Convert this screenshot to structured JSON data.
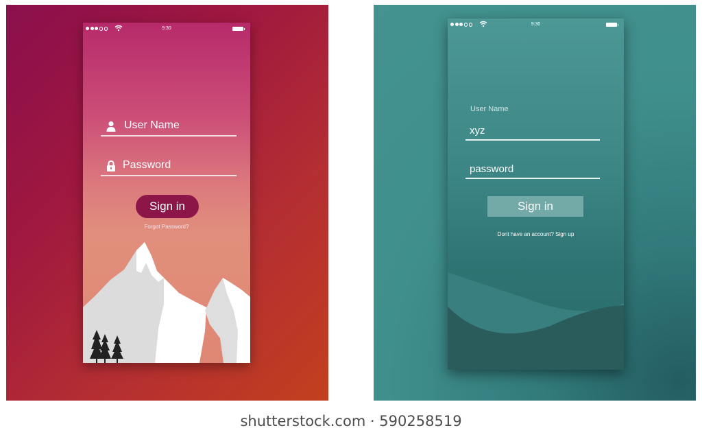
{
  "left_mockup": {
    "status": {
      "time": "9:30"
    },
    "username_label": "User Name",
    "password_label": "Password",
    "signin_label": "Sign in",
    "forgot_label": "Forgot Password?",
    "colors": {
      "accent": "#8c1648",
      "bg_top": "#b72a6a",
      "bg_bottom": "#e18f7c"
    }
  },
  "right_mockup": {
    "status": {
      "time": "9:30"
    },
    "username_caption": "User Name",
    "username_value": "xyz",
    "password_value": "password",
    "signin_label": "Sign in",
    "signup_label": "Dont have an account? Sign up",
    "colors": {
      "accent": "#73aaa7",
      "bg": "#3f8f8d"
    }
  },
  "watermark": "shutterstock.com · 590258519",
  "icons": [
    "signal-dots-icon",
    "wifi-icon",
    "battery-icon",
    "user-icon",
    "lock-icon",
    "mountain-illustration",
    "tree-icon",
    "wave-illustration"
  ]
}
